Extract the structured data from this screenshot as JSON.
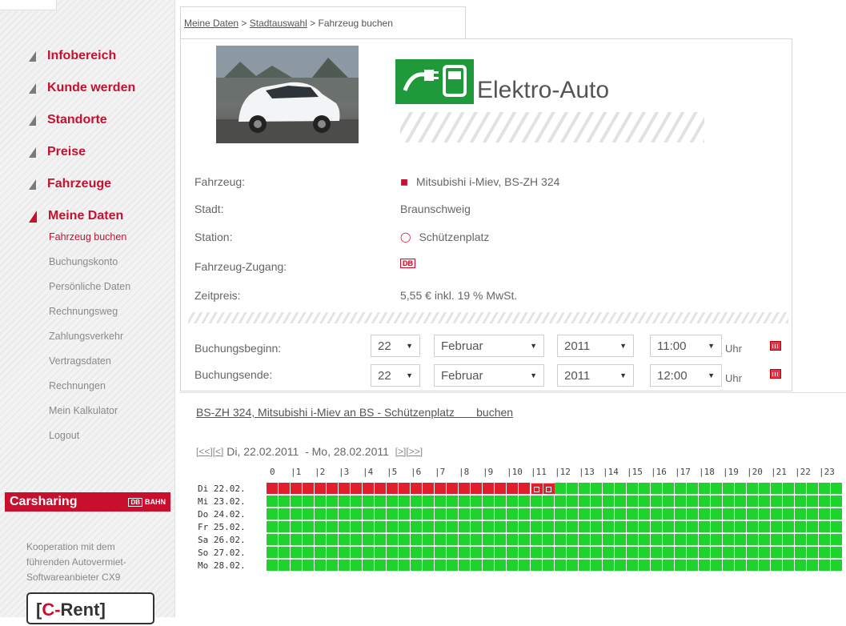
{
  "breadcrumb": {
    "items": [
      "Meine Daten",
      "Stadtauswahl",
      "Fahrzeug buchen"
    ],
    "sep": ">"
  },
  "nav": {
    "items": [
      {
        "label": "Infobereich"
      },
      {
        "label": "Kunde werden"
      },
      {
        "label": "Standorte"
      },
      {
        "label": "Preise"
      },
      {
        "label": "Fahrzeuge"
      },
      {
        "label": "Meine Daten"
      }
    ],
    "sub_items": [
      {
        "label": "Fahrzeug buchen"
      },
      {
        "label": "Buchungskonto"
      },
      {
        "label": "Persönliche Daten"
      },
      {
        "label": "Rechnungsweg"
      },
      {
        "label": "Zahlungsverkehr"
      },
      {
        "label": "Vertragsdaten"
      },
      {
        "label": "Rechnungen"
      },
      {
        "label": "Mein Kalkulator"
      },
      {
        "label": "Logout"
      }
    ]
  },
  "promo": {
    "title": "Carsharing",
    "brand": "BAHN",
    "brand_logo": "DB",
    "text": [
      "Kooperation mit dem",
      "führenden Autovermiet-",
      "Softwareanbieter CX9"
    ],
    "logo": {
      "bracket_open": "[",
      "c": "C-",
      "rest": "Rent",
      "bracket_close": "]"
    }
  },
  "vehicle": {
    "category": "Elektro-Auto",
    "icon": "ev-charging-icon",
    "fields": [
      {
        "label": "Fahrzeug:",
        "value": "Mitsubishi i-Miev, BS-ZH 324",
        "icon": "car-icon"
      },
      {
        "label": "Stadt:",
        "value": "Braunschweig",
        "icon": ""
      },
      {
        "label": "Station:",
        "value": "Schützenplatz",
        "icon": "station-icon"
      },
      {
        "label": "Fahrzeug-Zugang:",
        "value": "DB",
        "icon": "db-card-icon"
      },
      {
        "label": "Zeitpreis:",
        "value": "5,55 € inkl. 19 % MwSt.",
        "icon": ""
      }
    ]
  },
  "booking_form": {
    "start": {
      "label": "Buchungsbeginn:",
      "day": "22",
      "month": "Februar",
      "year": "2011",
      "time": "11:00",
      "unit": "Uhr"
    },
    "end": {
      "label": "Buchungsende:",
      "day": "22",
      "month": "Februar",
      "year": "2011",
      "time": "12:00",
      "unit": "Uhr"
    }
  },
  "booking_link": "BS-ZH 324, Mitsubishi i-Miev an BS - Schützenplatz       buchen",
  "week_nav": {
    "first": "[<<]",
    "prev": "[<]",
    "range": " Di, 22.02.2011  - Mo, 28.02.2011  ",
    "next": "[>]",
    "last": "[>>]"
  },
  "schedule": {
    "hours": [
      "0",
      "|1",
      "|2",
      "|3",
      "|4",
      "|5",
      "|6",
      "|7",
      "|8",
      "|9",
      "|10",
      "|11",
      "|12",
      "|13",
      "|14",
      "|15",
      "|16",
      "|17",
      "|18",
      "|19",
      "|20",
      "|21",
      "|22",
      "|23"
    ],
    "days": [
      {
        "label": "Di 22.02.",
        "busy_until_hour": 11,
        "selected_hour": 11
      },
      {
        "label": "Mi 23.02.",
        "busy_until_hour": 0,
        "selected_hour": null
      },
      {
        "label": "Do 24.02.",
        "busy_until_hour": 0,
        "selected_hour": null
      },
      {
        "label": "Fr 25.02.",
        "busy_until_hour": 0,
        "selected_hour": null
      },
      {
        "label": "Sa 26.02.",
        "busy_until_hour": 0,
        "selected_hour": null
      },
      {
        "label": "So 27.02.",
        "busy_until_hour": 0,
        "selected_hour": null
      },
      {
        "label": "Mo 28.02.",
        "busy_until_hour": 0,
        "selected_hour": null
      }
    ],
    "colors": {
      "free": "#1ed42c",
      "busy": "#e11e2d",
      "brand": "#c8102e"
    }
  }
}
